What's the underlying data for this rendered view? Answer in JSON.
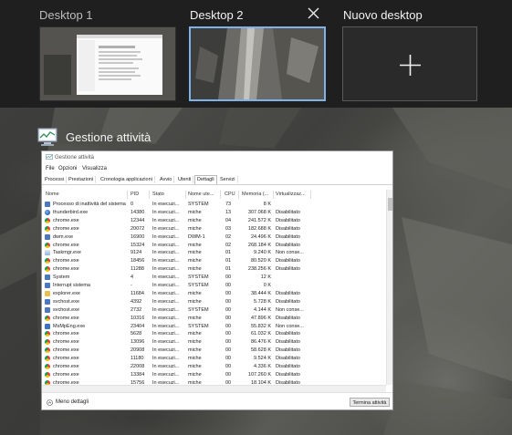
{
  "desktops": [
    {
      "label": "Desktop 1"
    },
    {
      "label": "Desktop 2"
    },
    {
      "label": "Nuovo desktop"
    }
  ],
  "window_caption": "Gestione attività",
  "task_manager": {
    "title": "Gestione attività",
    "menu": [
      "File",
      "Opzioni",
      "Visualizza"
    ],
    "tabs": [
      "Processi",
      "Prestazioni",
      "Cronologia applicazioni",
      "Avvio",
      "Utenti",
      "Dettagli",
      "Servizi"
    ],
    "active_tab": "Dettagli",
    "columns": [
      "Nome",
      "PID",
      "Stato",
      "Nome ute...",
      "CPU",
      "Memoria (...",
      "Virtualizzaz..."
    ],
    "rows": [
      [
        "Processo di inattività del sistema",
        "0",
        "In esecuzi...",
        "SYSTEM",
        "73",
        "8 K",
        ""
      ],
      [
        "thunderbird.exe",
        "14380",
        "In esecuzi...",
        "miche",
        "13",
        "307.068 K",
        "Disabilitato"
      ],
      [
        "chrome.exe",
        "12344",
        "In esecuzi...",
        "miche",
        "04",
        "241.572 K",
        "Disabilitato"
      ],
      [
        "chrome.exe",
        "20072",
        "In esecuzi...",
        "miche",
        "03",
        "182.688 K",
        "Disabilitato"
      ],
      [
        "dwm.exe",
        "16900",
        "In esecuzi...",
        "DWM-1",
        "02",
        "24.496 K",
        "Disabilitato"
      ],
      [
        "chrome.exe",
        "15324",
        "In esecuzi...",
        "miche",
        "02",
        "268.184 K",
        "Disabilitato"
      ],
      [
        "Taskmgr.exe",
        "9124",
        "In esecuzi...",
        "miche",
        "01",
        "9.240 K",
        "Non conse..."
      ],
      [
        "chrome.exe",
        "18456",
        "In esecuzi...",
        "miche",
        "01",
        "80.520 K",
        "Disabilitato"
      ],
      [
        "chrome.exe",
        "11288",
        "In esecuzi...",
        "miche",
        "01",
        "238.256 K",
        "Disabilitato"
      ],
      [
        "System",
        "4",
        "In esecuzi...",
        "SYSTEM",
        "00",
        "12 K",
        ""
      ],
      [
        "Interrupt sistema",
        "-",
        "In esecuzi...",
        "SYSTEM",
        "00",
        "0 K",
        ""
      ],
      [
        "explorer.exe",
        "11684",
        "In esecuzi...",
        "miche",
        "00",
        "38.444 K",
        "Disabilitato"
      ],
      [
        "svchost.exe",
        "4392",
        "In esecuzi...",
        "miche",
        "00",
        "5.728 K",
        "Disabilitato"
      ],
      [
        "svchost.exe",
        "2732",
        "In esecuzi...",
        "SYSTEM",
        "00",
        "4.144 K",
        "Non conse..."
      ],
      [
        "chrome.exe",
        "10316",
        "In esecuzi...",
        "miche",
        "00",
        "47.896 K",
        "Disabilitato"
      ],
      [
        "MsMpEng.exe",
        "23404",
        "In esecuzi...",
        "SYSTEM",
        "00",
        "55.832 K",
        "Non conse..."
      ],
      [
        "chrome.exe",
        "5628",
        "In esecuzi...",
        "miche",
        "00",
        "61.032 K",
        "Disabilitato"
      ],
      [
        "chrome.exe",
        "13096",
        "In esecuzi...",
        "miche",
        "00",
        "86.476 K",
        "Disabilitato"
      ],
      [
        "chrome.exe",
        "20908",
        "In esecuzi...",
        "miche",
        "00",
        "58.628 K",
        "Disabilitato"
      ],
      [
        "chrome.exe",
        "11180",
        "In esecuzi...",
        "miche",
        "00",
        "9.524 K",
        "Disabilitato"
      ],
      [
        "chrome.exe",
        "22008",
        "In esecuzi...",
        "miche",
        "00",
        "4.336 K",
        "Disabilitato"
      ],
      [
        "chrome.exe",
        "13384",
        "In esecuzi...",
        "miche",
        "00",
        "107.260 K",
        "Disabilitato"
      ],
      [
        "chrome.exe",
        "15756",
        "In esecuzi...",
        "miche",
        "00",
        "18.104 K",
        "Disabilitato"
      ]
    ],
    "row_icons": [
      "window-icon",
      "thunderbird-icon",
      "chrome-icon",
      "chrome-icon",
      "window-icon",
      "chrome-icon",
      "taskmgr-icon",
      "chrome-icon",
      "chrome-icon",
      "window-icon",
      "window-icon",
      "folder-icon",
      "window-icon",
      "window-icon",
      "chrome-icon",
      "shield-icon",
      "chrome-icon",
      "chrome-icon",
      "chrome-icon",
      "chrome-icon",
      "chrome-icon",
      "chrome-icon",
      "chrome-icon"
    ],
    "footer_left": "Meno dettagli",
    "end_task": "Termina attività"
  },
  "colors": {
    "bar_background": "#1f1f1f",
    "selected_border": "#7fb2e6",
    "chrome_red": "#db4437",
    "chrome_yellow": "#f4c20d",
    "chrome_green": "#0f9d58"
  }
}
